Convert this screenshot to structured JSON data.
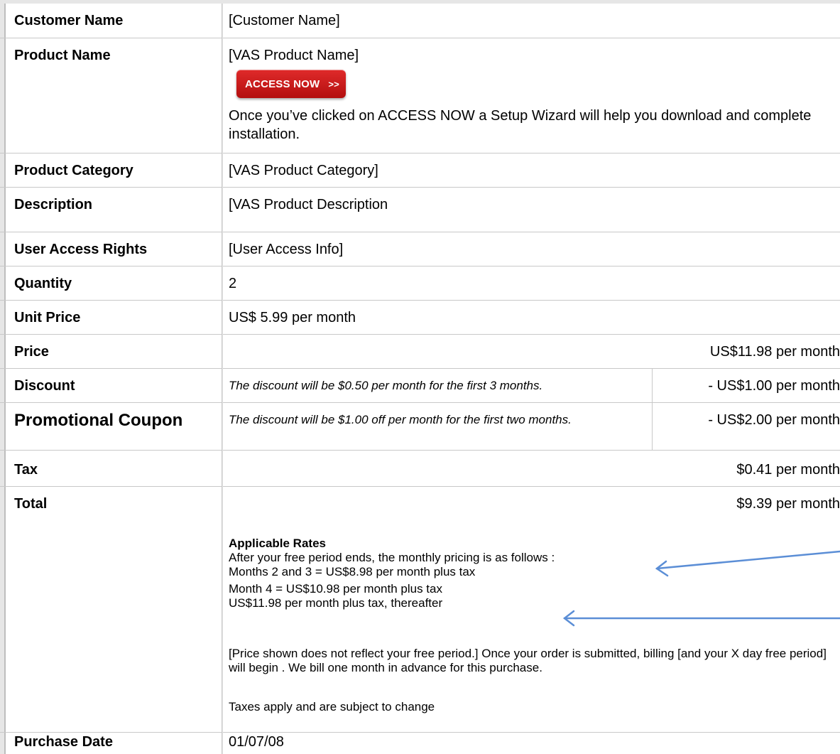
{
  "rows": {
    "customer_name": {
      "label": "Customer Name",
      "value": "[Customer Name]"
    },
    "product_name": {
      "label": "Product Name",
      "value": "[VAS Product Name]",
      "button": "ACCESS NOW",
      "button_chevron": ">>",
      "note": "Once  you’ve clicked on ACCESS NOW a Setup Wizard will help you download and complete installation."
    },
    "product_category": {
      "label": "Product Category",
      "value": "[VAS Product Category]"
    },
    "description": {
      "label": "Description",
      "value": "[VAS Product Description"
    },
    "user_access": {
      "label": "User Access Rights",
      "value": "[User Access Info]"
    },
    "quantity": {
      "label": "Quantity",
      "value": "2"
    },
    "unit_price": {
      "label": "Unit Price",
      "value": "US$ 5.99 per month"
    },
    "price": {
      "label": "Price",
      "value": "US$11.98 per month"
    },
    "discount": {
      "label": "Discount",
      "text": "The discount will be $0.50 per month for the first 3 months.",
      "value": "- US$1.00 per month"
    },
    "promo": {
      "label": "Promotional Coupon",
      "text": "The discount will be $1.00 off per month for the first two months.",
      "value": "- US$2.00 per month"
    },
    "tax": {
      "label": "Tax",
      "value": "$0.41 per month"
    },
    "total": {
      "label": "Total",
      "value": "$9.39 per month",
      "rates_heading": "Applicable Rates",
      "rates_lines": [
        "After your free period ends, the monthly pricing is as follows :",
        "Months 2 and 3 = US$8.98 per month plus tax",
        "Month 4 = US$10.98 per month plus tax",
        "US$11.98 per month plus tax, thereafter"
      ],
      "billing_note": "[Price shown does not reflect your free period.] Once your order is submitted, billing [and your X day free period] will begin . We bill one month in advance for this purchase.",
      "taxes_note": "Taxes apply and are subject to change"
    },
    "purchase_date": {
      "label": "Purchase Date",
      "value": "01/07/08"
    }
  },
  "colors": {
    "button": "#c81818",
    "arrow": "#5b8ed6",
    "grid": "#c8c8c8"
  }
}
